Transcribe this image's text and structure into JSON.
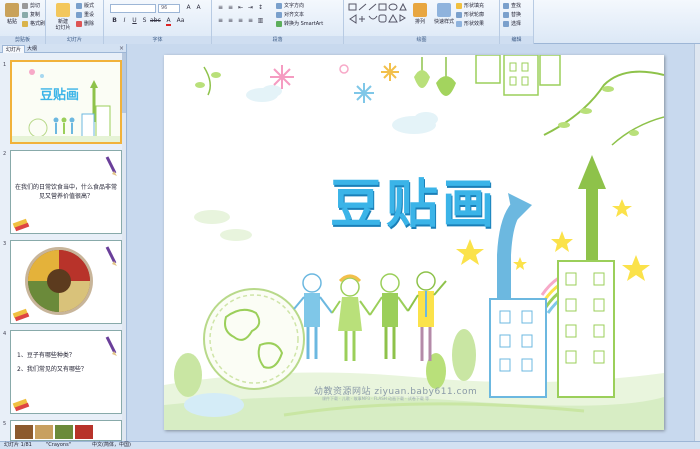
{
  "ribbon": {
    "clipboard": {
      "paste": "粘贴",
      "cut": "剪切",
      "copy": "复制",
      "format_painter": "格式刷",
      "label": "剪贴板"
    },
    "slides": {
      "new_slide": "新建\n幻灯片",
      "layout": "版式",
      "reset": "重设",
      "delete": "删除",
      "label": "幻灯片"
    },
    "font": {
      "font_name": "",
      "font_size": "96",
      "label": "字体"
    },
    "paragraph": {
      "text_direction": "文字方向",
      "align_text": "对齐文本",
      "smartart": "转换为 SmartArt",
      "label": "段落"
    },
    "drawing": {
      "arrange": "排列",
      "quick_styles": "快速样式",
      "shape_fill": "形状填充",
      "shape_outline": "形状轮廓",
      "shape_effects": "形状效果",
      "label": "绘图"
    },
    "editing": {
      "find": "查找",
      "replace": "替换",
      "select": "选择",
      "label": "编辑"
    }
  },
  "panel": {
    "tab_slides": "幻灯片",
    "tab_outline": "大纲",
    "close": "×",
    "slides": [
      {
        "num": "1",
        "title": "豆贴画"
      },
      {
        "num": "2",
        "text": "在我们的日常饮食当中，什么食品非常见又营养价值很高？"
      },
      {
        "num": "3"
      },
      {
        "num": "4",
        "line1": "1、豆子有哪些种类？",
        "line2": "2、我们常见的又有哪些？"
      },
      {
        "num": "5"
      }
    ]
  },
  "slide": {
    "title": "豆贴画",
    "watermark": "幼教资源网站  ziyuan.baby611.com",
    "watermark_sub": "课件下载 · 儿歌 · 故事MP3 · FLASH 动画下载 · 试卷下载 等"
  },
  "status": {
    "slide_pos": "幻灯片 1/81",
    "theme": "\"Crayons\"",
    "language": "中文(简体，中国)"
  },
  "colors": {
    "title_blue": "#3bb4e8",
    "ribbon_bg": "#dce8f6",
    "selected_thumb": "#f1b23a"
  }
}
